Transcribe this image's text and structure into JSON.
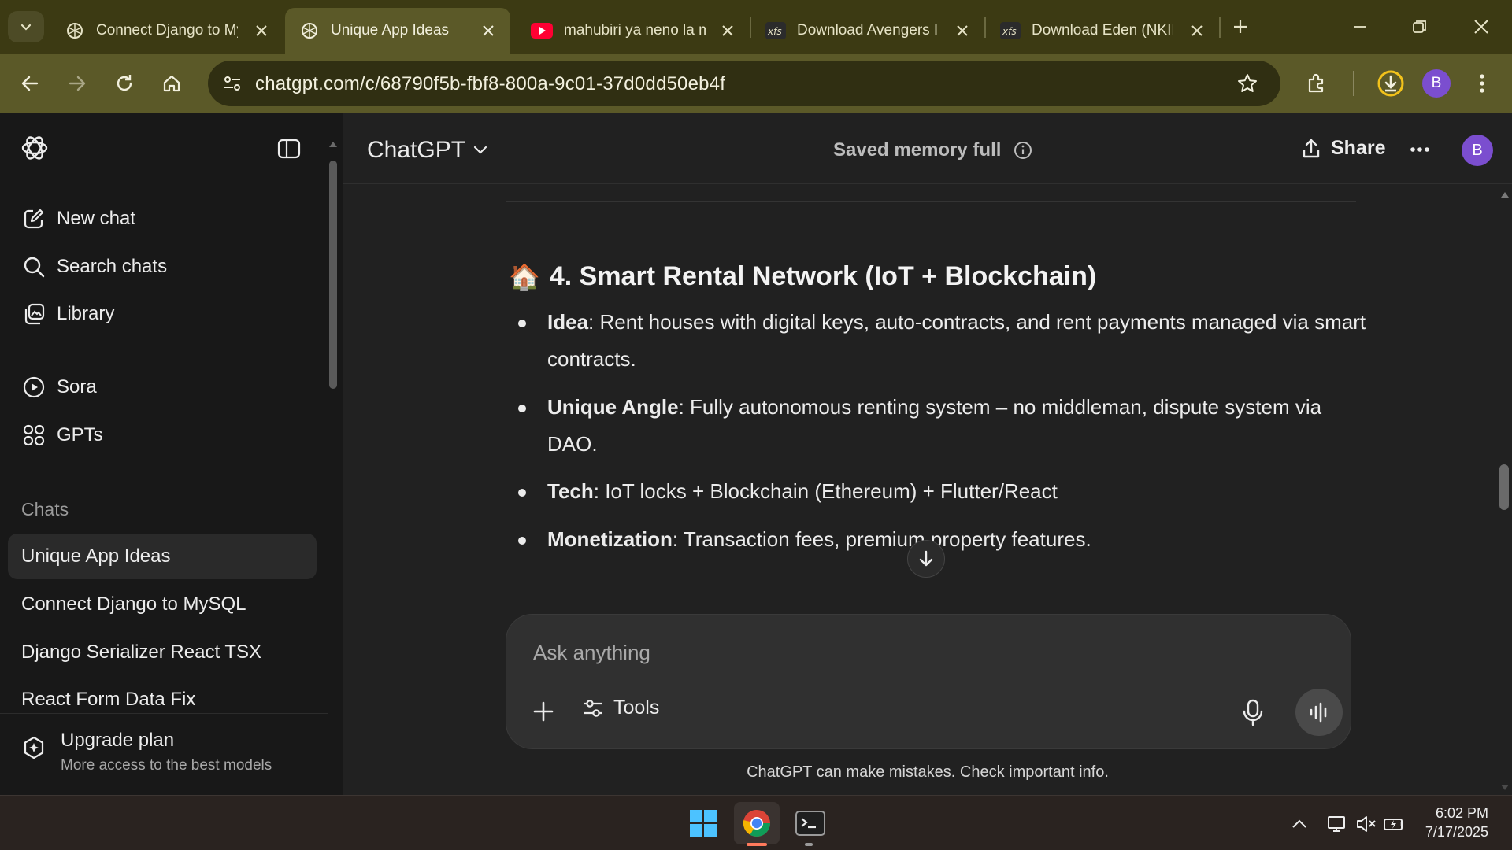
{
  "browser": {
    "tabs": [
      {
        "title": "Connect Django to MySQL",
        "icon": "chatgpt-icon",
        "active": false
      },
      {
        "title": "Unique App Ideas",
        "icon": "chatgpt-icon",
        "active": true
      },
      {
        "title": "mahubiri ya neno la mungu",
        "icon": "youtube-icon",
        "active": false
      },
      {
        "title": "Download Avengers Infinity War",
        "icon": "xfs-icon",
        "active": false
      },
      {
        "title": "Download Eden (NKIRI)",
        "icon": "xfs-icon",
        "active": false
      }
    ],
    "url": "chatgpt.com/c/68790f5b-fbf8-800a-9c01-37d0dd50eb4f",
    "profile_initial": "B"
  },
  "sidebar": {
    "nav": [
      {
        "label": "New chat",
        "icon": "edit-icon"
      },
      {
        "label": "Search chats",
        "icon": "search-icon"
      },
      {
        "label": "Library",
        "icon": "library-icon"
      },
      {
        "label": "Sora",
        "icon": "play-circle-icon"
      },
      {
        "label": "GPTs",
        "icon": "grid-icon"
      }
    ],
    "section_label": "Chats",
    "chats": [
      {
        "label": "Unique App Ideas",
        "active": true
      },
      {
        "label": "Connect Django to MySQL",
        "active": false
      },
      {
        "label": "Django Serializer React TSX",
        "active": false
      },
      {
        "label": "React Form Data Fix",
        "active": false
      }
    ],
    "upgrade": {
      "title": "Upgrade plan",
      "subtitle": "More access to the best models"
    }
  },
  "header": {
    "model": "ChatGPT",
    "memory": "Saved memory full",
    "share": "Share",
    "avatar": "B"
  },
  "message": {
    "heading_emoji": "🏠",
    "heading": "4. Smart Rental Network (IoT + Blockchain)",
    "bullets": [
      {
        "label": "Idea",
        "text": ": Rent houses with digital keys, auto-contracts, and rent payments managed via smart contracts."
      },
      {
        "label": "Unique Angle",
        "text": ": Fully autonomous renting system – no middleman, dispute system via DAO."
      },
      {
        "label": "Tech",
        "text": ": IoT locks + Blockchain (Ethereum) + Flutter/React"
      },
      {
        "label": "Monetization",
        "text": ": Transaction fees, premium property features."
      }
    ]
  },
  "composer": {
    "placeholder": "Ask anything",
    "tools": "Tools"
  },
  "disclaimer": "ChatGPT can make mistakes. Check important info.",
  "taskbar": {
    "time": "6:02 PM",
    "date": "7/17/2025"
  },
  "colors": {
    "tab_strip": "#3c3a13",
    "toolbar": "#5b5928",
    "sidebar": "#181818",
    "main": "#212121",
    "avatar": "#7b4ecf"
  }
}
